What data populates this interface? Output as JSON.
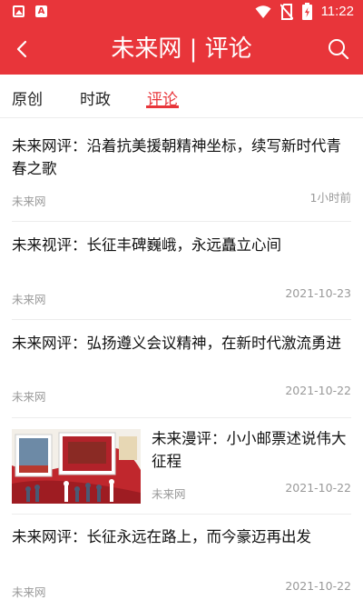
{
  "status_bar": {
    "time": "11:22",
    "icons": [
      "image-icon",
      "a-icon",
      "wifi-icon",
      "sim-off-icon",
      "battery-icon"
    ]
  },
  "header": {
    "title": "未来网 | 评论",
    "background_color": "#e8353a",
    "back_icon": "chevron-left-icon",
    "search_icon": "search-icon"
  },
  "tabs": [
    {
      "label": "原创",
      "active": false
    },
    {
      "label": "时政",
      "active": false
    },
    {
      "label": "评论",
      "active": true
    }
  ],
  "accent_color": "#e8353a",
  "news": [
    {
      "title": "未来网评：沿着抗美援朝精神坐标，续写新时代青春之歌",
      "source": "未来网",
      "time": "1小时前",
      "has_image": false
    },
    {
      "title": "未来视评：长征丰碑巍峨，永远矗立心间",
      "source": "未来网",
      "time": "2021-10-23",
      "has_image": false
    },
    {
      "title": "未来网评：弘扬遵义会议精神，在新时代激流勇进",
      "source": "未来网",
      "time": "2021-10-22",
      "has_image": false
    },
    {
      "title": "未来漫评：小小邮票述说伟大征程",
      "source": "未来网",
      "time": "2021-10-22",
      "has_image": true,
      "image_subject": "stamps-collage"
    },
    {
      "title": "未来网评：长征永远在路上，而今豪迈再出发",
      "source": "未来网",
      "time": "2021-10-22",
      "has_image": false
    }
  ]
}
